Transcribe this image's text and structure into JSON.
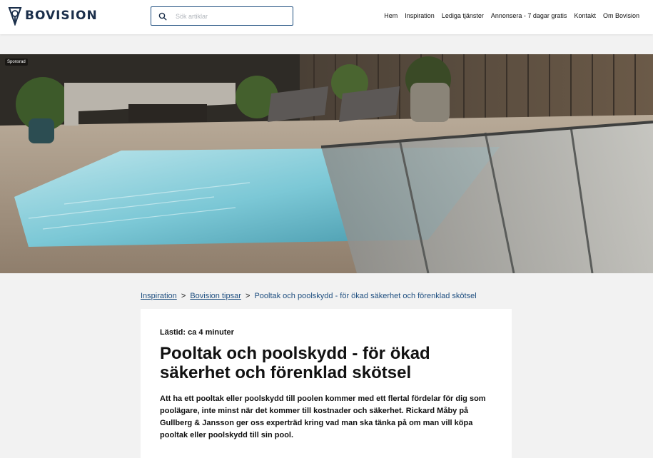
{
  "header": {
    "logo_text": "BOVISION",
    "search": {
      "placeholder": "Sök artiklar",
      "value": ""
    },
    "nav": [
      {
        "label": "Hem"
      },
      {
        "label": "Inspiration"
      },
      {
        "label": "Lediga tjänster"
      },
      {
        "label": "Annonsera - 7 dagar gratis"
      },
      {
        "label": "Kontakt"
      },
      {
        "label": "Om Bovision"
      }
    ]
  },
  "hero": {
    "badge": "Sponsrad"
  },
  "breadcrumb": {
    "items": [
      {
        "label": "Inspiration"
      },
      {
        "label": "Bovision tipsar"
      }
    ],
    "current": "Pooltak och poolskydd - för ökad säkerhet och förenklad skötsel",
    "separator": ">"
  },
  "article": {
    "readtime": "Lästid: ca 4 minuter",
    "title": "Pooltak och poolskydd - för ökad säkerhet och förenklad skötsel",
    "lead": "Att ha ett pooltak eller poolskydd till poolen kommer med ett flertal fördelar för dig som poolägare, inte minst när det kommer till kostnader och säkerhet. Rickard Måby på Gullberg & Jansson ger oss experträd kring vad man ska tänka på om man vill köpa pooltak eller poolskydd till sin pool."
  },
  "colors": {
    "brand": "#1a2e4a",
    "link": "#1f4f80",
    "background": "#f2f2f2"
  }
}
